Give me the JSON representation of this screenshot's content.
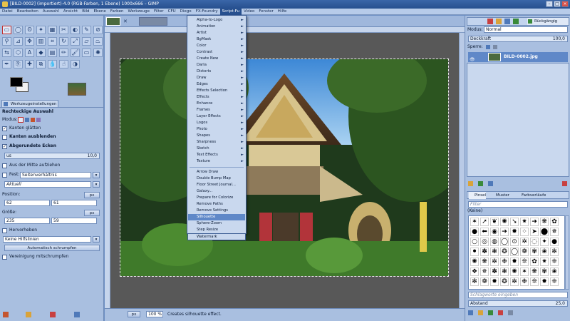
{
  "window": {
    "title": "[BILD-0002] (importiert)-4.0 (RGB-Farben, 1 Ebene) 1000x666 – GIMP"
  },
  "menubar": {
    "items": [
      "Datei",
      "Bearbeiten",
      "Auswahl",
      "Ansicht",
      "Bild",
      "Ebene",
      "Farben",
      "Werkzeuge",
      "Filter",
      "CFU",
      "Diego",
      "FX-Foundry",
      "Script-Fu",
      "Video",
      "Fenster",
      "Hilfe"
    ],
    "active": "Script-Fu"
  },
  "script_fu_menu": {
    "items": [
      "Alpha-to-Logo",
      "Animation",
      "Artist",
      "BgMask",
      "Color",
      "Contrast",
      "Create New",
      "Darla",
      "Distorts",
      "Draw",
      "Edges",
      "Effects Selection",
      "Effects",
      "Enhance",
      "Frames",
      "Layer Effects",
      "Logos",
      "Photo",
      "Shapes",
      "Sharpness",
      "Sketch",
      "Text Effects",
      "Texture"
    ],
    "actions": [
      "Arrow Draw",
      "Double Bump Map",
      "Floor Street Journal...",
      "Galaxy...",
      "Prepare for Colorize",
      "Remove Paths",
      "Remove Settings",
      "Silhouette",
      "Sphere-Zoom",
      "Step Resize",
      "Watermark"
    ],
    "highlighted": "Silhouette"
  },
  "tool_options": {
    "tab_label": "Werkzeugeinstellungen",
    "tool_title": "Rechteckige Auswahl",
    "modus_label": "Modus:",
    "antialias_label": "Kanten glätten",
    "feather_label": "Kanten ausblenden",
    "rounded_label": "Abgerundete Ecken",
    "radius_label": "us",
    "radius_value": "10,0",
    "from_center_label": "Aus der Mitte aufziehen",
    "fixed_label": "Fest:",
    "fixed_value": "Seitenverhältnis",
    "current_value": "Aktuell",
    "position_label": "Position:",
    "position_x": "62",
    "position_y": "61",
    "unit": "px",
    "size_label": "Größe:",
    "size_w": "235",
    "size_h": "59",
    "highlight_label": "Hervorheben",
    "guides_value": "Keine Hilfslinien",
    "autoshrink_button": "Automatisch schrumpfen",
    "merged_label": "Vereinigung mitschrumpfen"
  },
  "layers_panel": {
    "back_button": "Rückgängig",
    "mode_label": "Modus:",
    "mode_value": "Normal",
    "opacity_label": "Deckkraft",
    "opacity_value": "100,0",
    "lock_label": "Sperre:",
    "layer_name": "BILD-0002.jpg"
  },
  "brushes_panel": {
    "tabs": [
      "Pinsel",
      "Muster",
      "Farbverläufe"
    ],
    "filter_placeholder": "Filter",
    "selected_brush": "(Keine)",
    "tag_placeholder": "Schlagworte eingeben",
    "spacing_label": "Abstand",
    "spacing_value": "25,0"
  },
  "status": {
    "unit": "px",
    "zoom": "100 %",
    "message": "Creates silhouette effect."
  },
  "colors": {
    "accent": "#27508f",
    "panel": "#a9bfe0",
    "highlight": "#5f88c8"
  }
}
